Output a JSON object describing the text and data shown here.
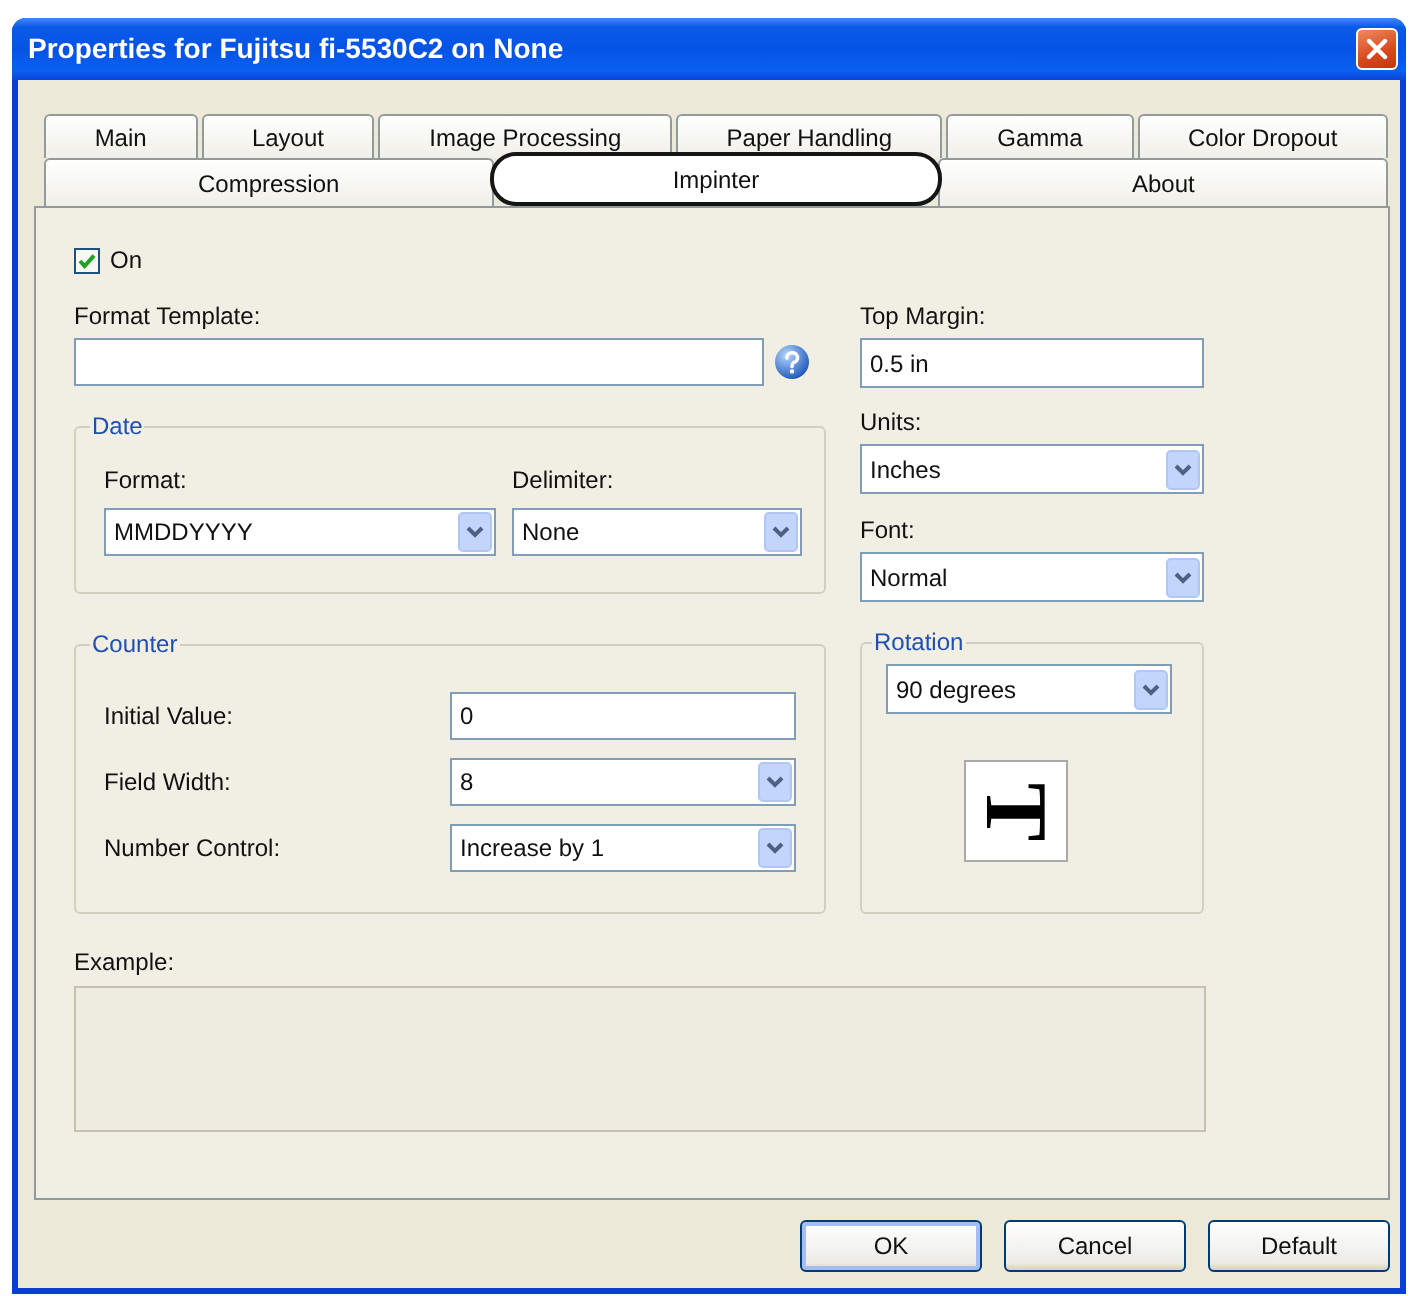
{
  "window": {
    "title": "Properties for Fujitsu fi-5530C2 on None"
  },
  "tab_rows": [
    {
      "tabs": [
        {
          "label": "Main",
          "selected": false
        },
        {
          "label": "Layout",
          "selected": false
        },
        {
          "label": "Image Processing",
          "selected": false
        },
        {
          "label": "Paper Handling",
          "selected": false
        },
        {
          "label": "Gamma",
          "selected": false
        },
        {
          "label": "Color Dropout",
          "selected": false
        }
      ]
    },
    {
      "tabs": [
        {
          "label": "Compression",
          "selected": false
        },
        {
          "label": "Impinter",
          "selected": true
        },
        {
          "label": "About",
          "selected": false
        }
      ]
    }
  ],
  "on_checkbox": {
    "label": "On",
    "checked": true
  },
  "format_template": {
    "label": "Format Template:"
  },
  "date_group": {
    "title": "Date",
    "format": {
      "label": "Format:",
      "value": "MMDDYYYY"
    },
    "delimiter": {
      "label": "Delimiter:",
      "value": "None"
    }
  },
  "counter_group": {
    "title": "Counter",
    "rows": [
      {
        "kind": "text",
        "label": "Initial Value:",
        "value": "0"
      },
      {
        "kind": "dropdown",
        "label": "Field Width:",
        "value": "8"
      },
      {
        "kind": "dropdown",
        "label": "Number Control:",
        "value": "Increase by 1"
      }
    ]
  },
  "top_margin": {
    "label": "Top Margin:",
    "value": "0.5 in"
  },
  "units": {
    "label": "Units:",
    "value": "Inches"
  },
  "font": {
    "label": "Font:",
    "value": "Normal"
  },
  "rotation_group": {
    "title": "Rotation",
    "value": "90 degrees",
    "preview": "T"
  },
  "example": {
    "label": "Example:"
  },
  "buttons": [
    {
      "label": "OK",
      "default": true
    },
    {
      "label": "Cancel",
      "default": false
    },
    {
      "label": "Default",
      "default": false
    }
  ]
}
